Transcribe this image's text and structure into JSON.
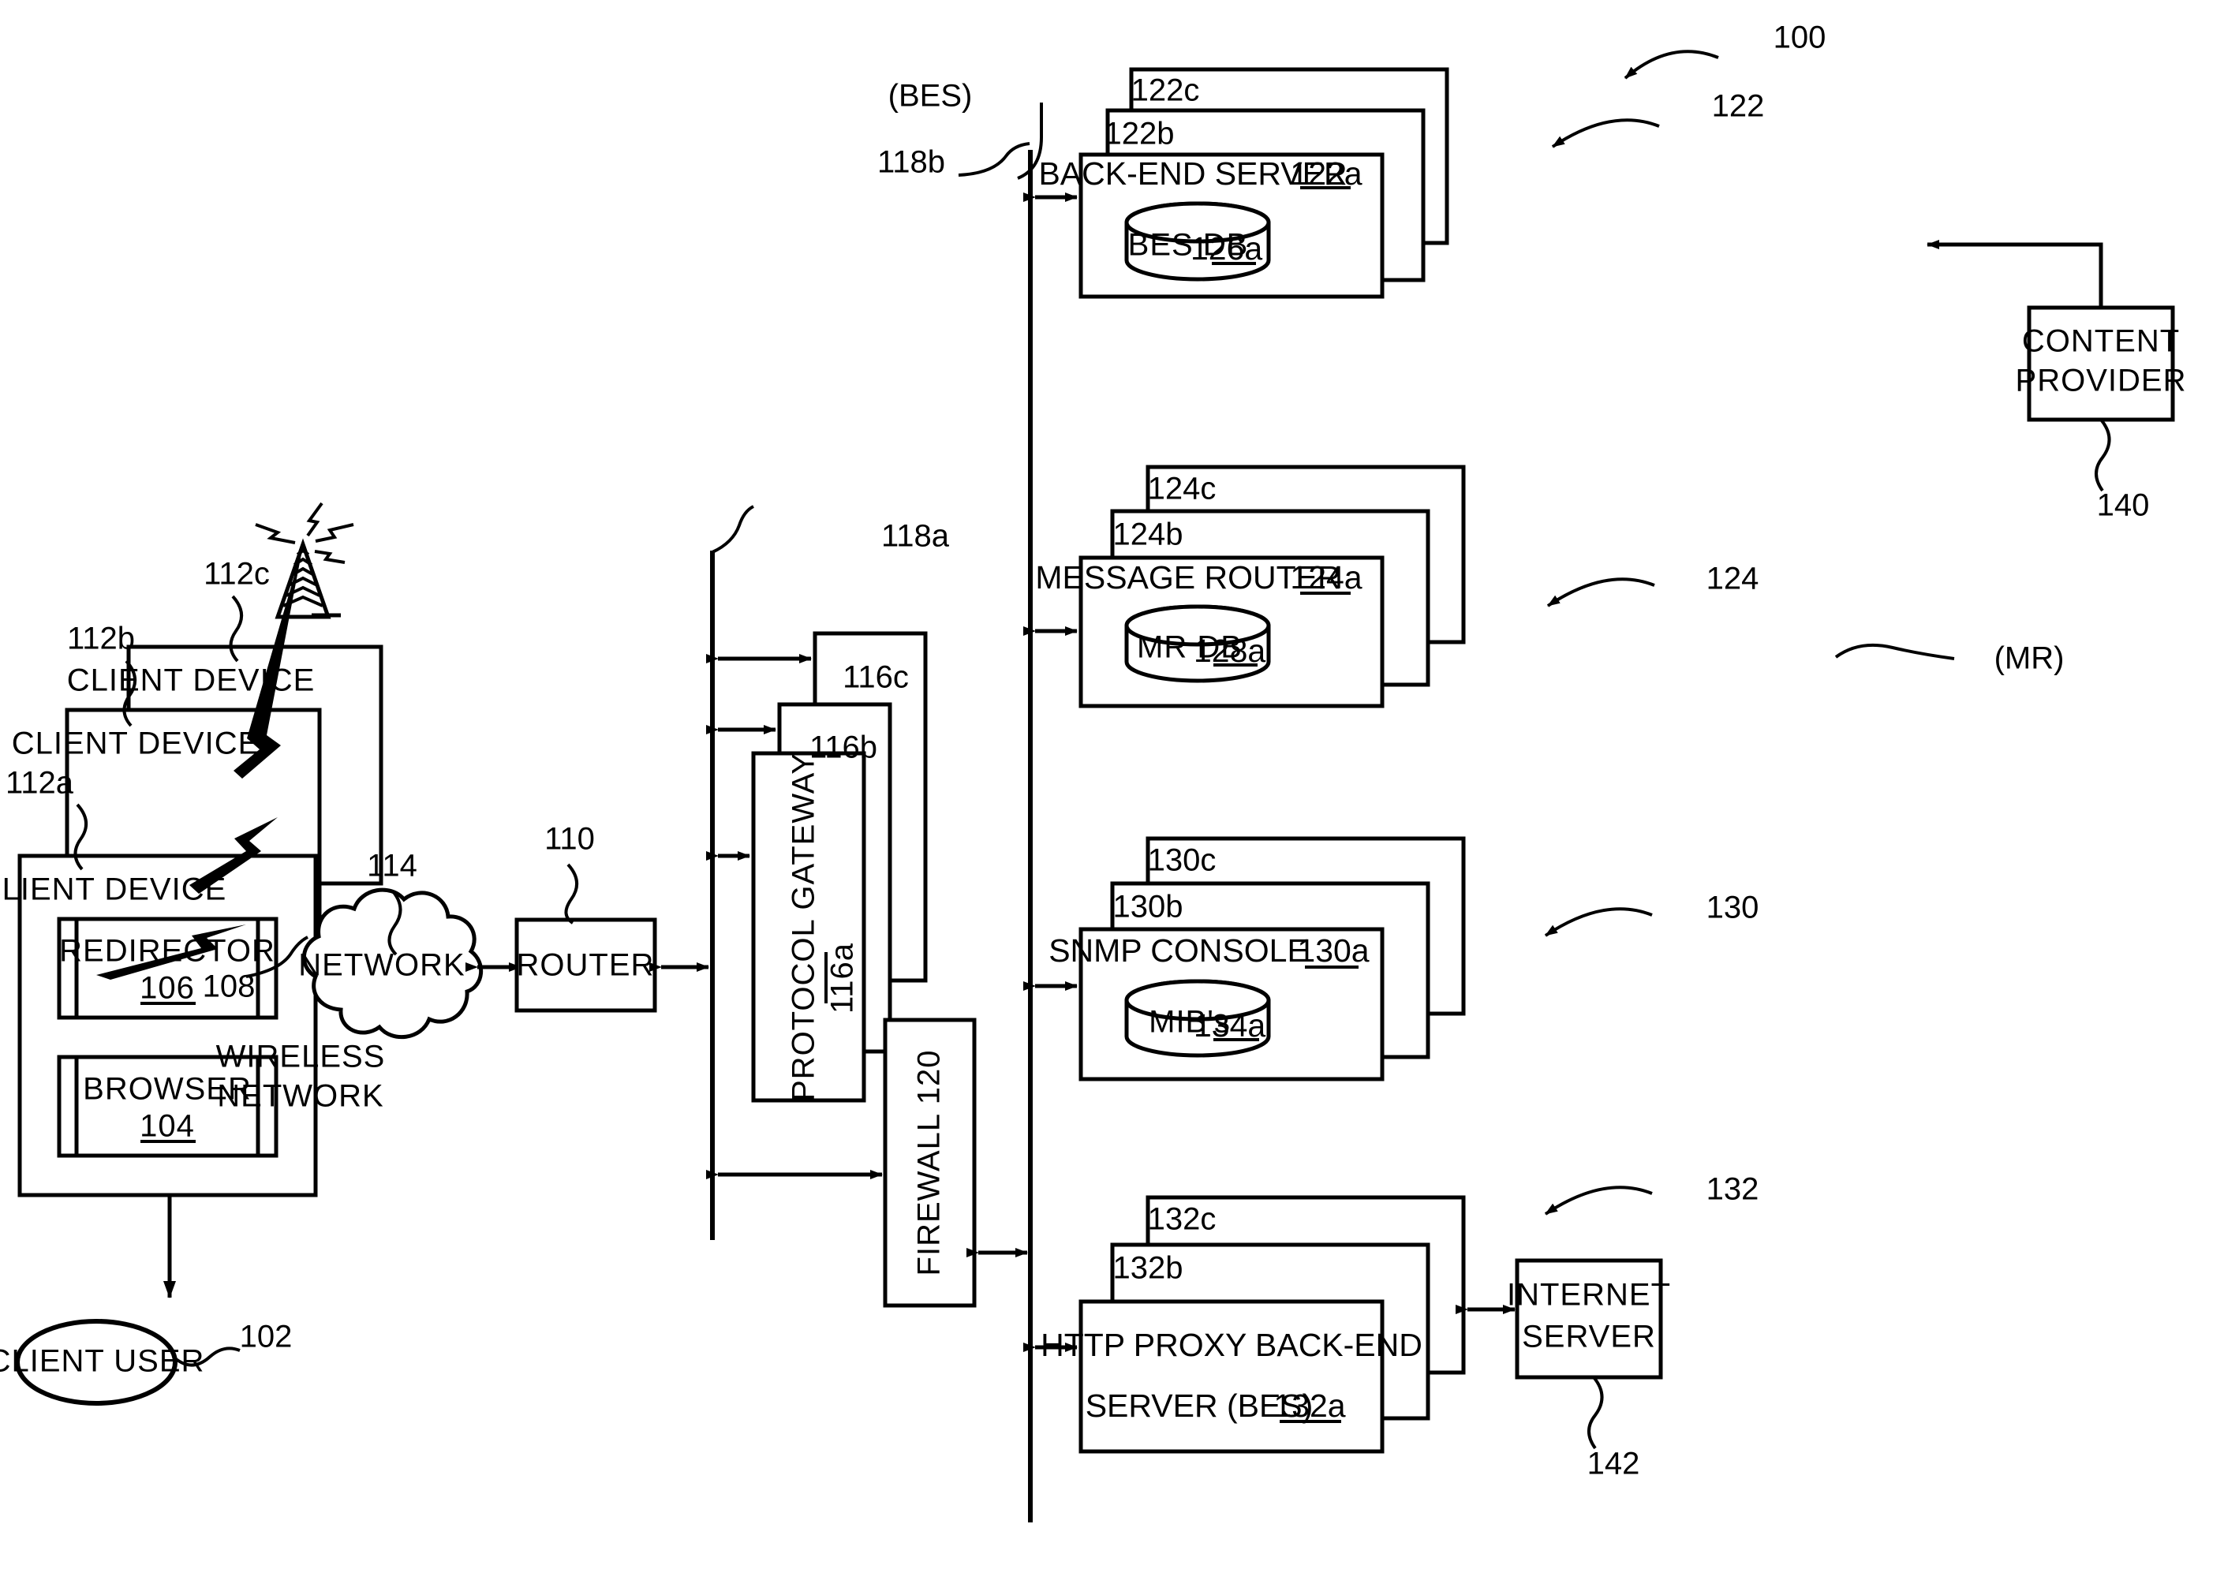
{
  "figure": {
    "system_ref": "100",
    "client_user": {
      "label": "CLIENT USER",
      "ref": "102"
    },
    "client_devices": {
      "label": "CLIENT DEVICE",
      "refs": [
        "112a",
        "112b",
        "112c"
      ],
      "browser": {
        "label": "BROWSER",
        "ref": "104"
      },
      "redirector": {
        "label": "REDIRECTOR",
        "ref": "106"
      }
    },
    "wireless_network": {
      "label_line1": "WIRELESS",
      "label_line2": "NETWORK",
      "ref": "108"
    },
    "network": {
      "label": "NETWORK",
      "ref": "114"
    },
    "router": {
      "label": "ROUTER",
      "ref": "110"
    },
    "bus_a": {
      "ref": "118a"
    },
    "bus_b": {
      "ref": "118b"
    },
    "protocol_gateway": {
      "label": "PROTOCOL GATEWAY",
      "ref": "116a",
      "refs": [
        "116a",
        "116b",
        "116c"
      ]
    },
    "firewall": {
      "label": "FIREWALL 120",
      "ref": "120"
    },
    "back_end_server": {
      "label": "BACK-END SERVER",
      "ref": "122a",
      "refs": [
        "122a",
        "122b",
        "122c"
      ],
      "group_ref": "122",
      "acronym": "(BES)",
      "db": {
        "label": "BES DB",
        "ref": "126a"
      }
    },
    "message_router": {
      "label": "MESSAGE ROUTER",
      "ref": "124a",
      "refs": [
        "124a",
        "124b",
        "124c"
      ],
      "group_ref": "124",
      "acronym": "(MR)",
      "db": {
        "label": "MR DB",
        "ref": "128a"
      }
    },
    "snmp_console": {
      "label": "SNMP CONSOLE",
      "ref": "130a",
      "refs": [
        "130a",
        "130b",
        "130c"
      ],
      "group_ref": "130",
      "db": {
        "label": "MIB's",
        "ref": "134a"
      }
    },
    "http_proxy_bes": {
      "label_line1": "HTTP PROXY BACK-END",
      "label_line2": "SERVER (BES)",
      "ref": "132a",
      "refs": [
        "132a",
        "132b",
        "132c"
      ],
      "group_ref": "132"
    },
    "content_provider": {
      "label_line1": "CONTENT",
      "label_line2": "PROVIDER",
      "ref": "140"
    },
    "internet_server": {
      "label_line1": "INTERNET",
      "label_line2": "SERVER",
      "ref": "142"
    },
    "colors": {
      "ink": "#000000",
      "paper": "#ffffff"
    }
  }
}
